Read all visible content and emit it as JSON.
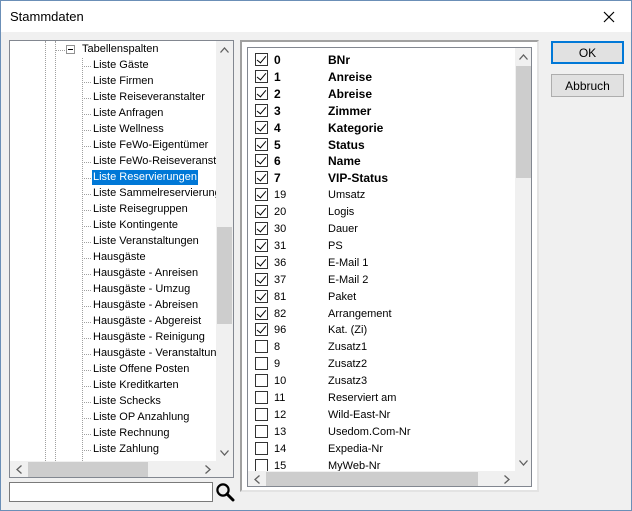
{
  "window": {
    "title": "Stammdaten"
  },
  "tree": {
    "parent_label": "Tabellenspalten",
    "items": [
      "Liste Gäste",
      "Liste Firmen",
      "Liste Reiseveranstalter",
      "Liste Anfragen",
      "Liste Wellness",
      "Liste FeWo-Eigentümer",
      "Liste FeWo-Reiseveransta",
      "Liste Reservierungen",
      "Liste Sammelreservierunge",
      "Liste Reisegruppen",
      "Liste Kontingente",
      "Liste Veranstaltungen",
      "Hausgäste",
      "Hausgäste - Anreisen",
      "Hausgäste - Umzug",
      "Hausgäste - Abreisen",
      "Hausgäste - Abgereist",
      "Hausgäste - Reinigung",
      "Hausgäste - Veranstaltung",
      "Liste Offene Posten",
      "Liste Kreditkarten",
      "Liste Schecks",
      "Liste OP Anzahlung",
      "Liste Rechnung",
      "Liste Zahlung"
    ],
    "selected": "Liste Reservierungen"
  },
  "search": {
    "value": ""
  },
  "columns": [
    {
      "num": "0",
      "name": "BNr",
      "checked": true,
      "bold": true
    },
    {
      "num": "1",
      "name": "Anreise",
      "checked": true,
      "bold": true
    },
    {
      "num": "2",
      "name": "Abreise",
      "checked": true,
      "bold": true
    },
    {
      "num": "3",
      "name": "Zimmer",
      "checked": true,
      "bold": true
    },
    {
      "num": "4",
      "name": "Kategorie",
      "checked": true,
      "bold": true
    },
    {
      "num": "5",
      "name": "Status",
      "checked": true,
      "bold": true
    },
    {
      "num": "6",
      "name": "Name",
      "checked": true,
      "bold": true
    },
    {
      "num": "7",
      "name": "VIP-Status",
      "checked": true,
      "bold": true
    },
    {
      "num": "19",
      "name": "Umsatz",
      "checked": true,
      "bold": false
    },
    {
      "num": "20",
      "name": "Logis",
      "checked": true,
      "bold": false
    },
    {
      "num": "30",
      "name": "Dauer",
      "checked": true,
      "bold": false
    },
    {
      "num": "31",
      "name": "PS",
      "checked": true,
      "bold": false
    },
    {
      "num": "36",
      "name": "E-Mail 1",
      "checked": true,
      "bold": false
    },
    {
      "num": "37",
      "name": "E-Mail 2",
      "checked": true,
      "bold": false
    },
    {
      "num": "81",
      "name": "Paket",
      "checked": true,
      "bold": false
    },
    {
      "num": "82",
      "name": "Arrangement",
      "checked": true,
      "bold": false
    },
    {
      "num": "96",
      "name": "Kat. (Zi)",
      "checked": true,
      "bold": false
    },
    {
      "num": "8",
      "name": "Zusatz1",
      "checked": false,
      "bold": false
    },
    {
      "num": "9",
      "name": "Zusatz2",
      "checked": false,
      "bold": false
    },
    {
      "num": "10",
      "name": "Zusatz3",
      "checked": false,
      "bold": false
    },
    {
      "num": "11",
      "name": "Reserviert am",
      "checked": false,
      "bold": false
    },
    {
      "num": "12",
      "name": "Wild-East-Nr",
      "checked": false,
      "bold": false
    },
    {
      "num": "13",
      "name": "Usedom.Com-Nr",
      "checked": false,
      "bold": false
    },
    {
      "num": "14",
      "name": "Expedia-Nr",
      "checked": false,
      "bold": false
    },
    {
      "num": "15",
      "name": "MyWeb-Nr",
      "checked": false,
      "bold": false
    }
  ],
  "buttons": {
    "ok": "OK",
    "cancel": "Abbruch"
  },
  "icons": {
    "close": "close-icon",
    "search": "magnifier-icon",
    "collapse": "tree-collapse-icon"
  },
  "colors": {
    "selection": "#0078d7",
    "border": "#828790",
    "face": "#f0f0f0"
  }
}
